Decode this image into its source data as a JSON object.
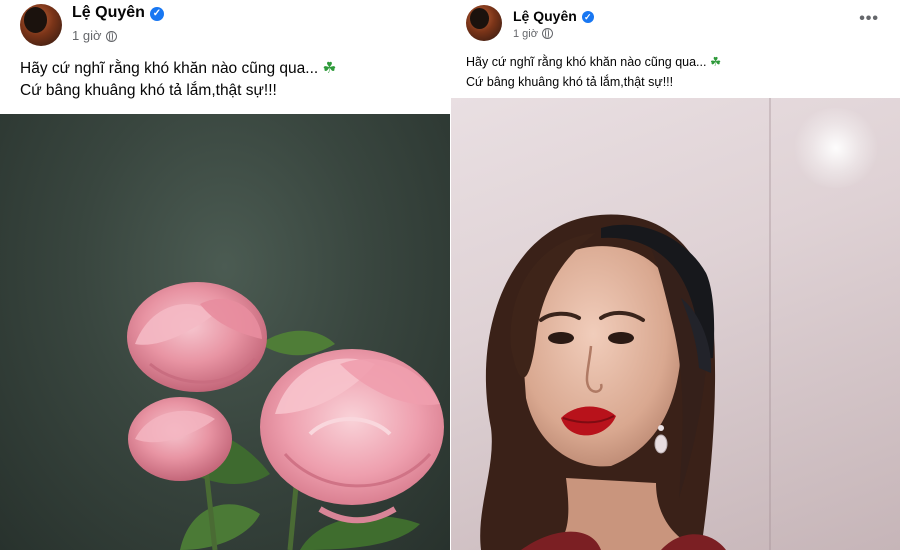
{
  "posts": [
    {
      "author": "Lệ Quyên",
      "timestamp": "1 giờ",
      "caption_line1": "Hãy cứ nghĩ rằng khó khăn nào cũng qua...",
      "caption_line2": "Cứ bâng khuâng khó tả lắm,thật sự!!!",
      "caption_emoji": "☘",
      "photo_icon": "peony-flowers-photo"
    },
    {
      "author": "Lệ Quyên",
      "timestamp": "1 giờ",
      "caption_line1": "Hãy cứ nghĩ rằng khó khăn nào cũng qua...",
      "caption_line2": "Cứ bâng khuâng khó tả lắm,thật sự!!!",
      "caption_emoji": "☘",
      "more_label": "•••",
      "photo_icon": "selfie-photo"
    }
  ],
  "colors": {
    "verified_badge": "#1877f2",
    "meta_text": "#65676b",
    "text": "#050505"
  }
}
